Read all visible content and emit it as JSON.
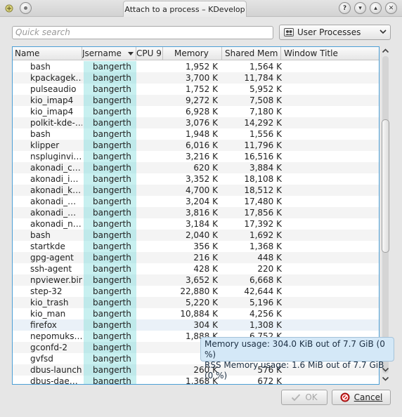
{
  "window": {
    "title": "Attach to a process – KDevelop",
    "controls": [
      "?",
      "▾",
      "▴",
      "✕"
    ]
  },
  "search": {
    "placeholder": "Quick search",
    "value": ""
  },
  "filter": {
    "selected": "User Processes"
  },
  "table": {
    "columns": [
      "Name",
      "Username",
      "CPU %",
      "Memory",
      "Shared Mem",
      "Window Title"
    ],
    "column_labels_visible": [
      "Name",
      "Jsername",
      "CPU 9",
      "Memory",
      "Shared Mem",
      "Window Title"
    ],
    "highlighted_row": 23,
    "rows": [
      {
        "name": "bash",
        "user": "bangerth",
        "mem": "1,952 K",
        "shm": "1,564 K"
      },
      {
        "name": "kpackagek…",
        "user": "bangerth",
        "mem": "3,700 K",
        "shm": "11,784 K"
      },
      {
        "name": "pulseaudio",
        "user": "bangerth",
        "mem": "1,752 K",
        "shm": "5,952 K"
      },
      {
        "name": "kio_imap4",
        "user": "bangerth",
        "mem": "9,272 K",
        "shm": "7,508 K"
      },
      {
        "name": "kio_imap4",
        "user": "bangerth",
        "mem": "6,928 K",
        "shm": "7,180 K"
      },
      {
        "name": "polkit-kde-…",
        "user": "bangerth",
        "mem": "3,076 K",
        "shm": "14,292 K"
      },
      {
        "name": "bash",
        "user": "bangerth",
        "mem": "1,948 K",
        "shm": "1,556 K"
      },
      {
        "name": "klipper",
        "user": "bangerth",
        "mem": "6,016 K",
        "shm": "11,796 K"
      },
      {
        "name": "nspluginvi…",
        "user": "bangerth",
        "mem": "3,216 K",
        "shm": "16,516 K"
      },
      {
        "name": "akonadi_c…",
        "user": "bangerth",
        "mem": "620 K",
        "shm": "3,884 K"
      },
      {
        "name": "akonadi_i…",
        "user": "bangerth",
        "mem": "3,352 K",
        "shm": "18,108 K"
      },
      {
        "name": "akonadi_k…",
        "user": "bangerth",
        "mem": "4,700 K",
        "shm": "18,512 K"
      },
      {
        "name": "akonadi_…",
        "user": "bangerth",
        "mem": "3,204 K",
        "shm": "17,480 K"
      },
      {
        "name": "akonadi_…",
        "user": "bangerth",
        "mem": "3,816 K",
        "shm": "17,856 K"
      },
      {
        "name": "akonadi_n…",
        "user": "bangerth",
        "mem": "3,184 K",
        "shm": "17,392 K"
      },
      {
        "name": "bash",
        "user": "bangerth",
        "mem": "2,040 K",
        "shm": "1,692 K"
      },
      {
        "name": "startkde",
        "user": "bangerth",
        "mem": "356 K",
        "shm": "1,368 K"
      },
      {
        "name": "gpg-agent",
        "user": "bangerth",
        "mem": "216 K",
        "shm": "448 K"
      },
      {
        "name": "ssh-agent",
        "user": "bangerth",
        "mem": "428 K",
        "shm": "220 K"
      },
      {
        "name": "npviewer.bin",
        "user": "bangerth",
        "mem": "3,652 K",
        "shm": "6,668 K"
      },
      {
        "name": "step-32",
        "user": "bangerth",
        "mem": "22,880 K",
        "shm": "42,644 K"
      },
      {
        "name": "kio_trash",
        "user": "bangerth",
        "mem": "5,220 K",
        "shm": "5,196 K"
      },
      {
        "name": "kio_man",
        "user": "bangerth",
        "mem": "10,884 K",
        "shm": "4,256 K"
      },
      {
        "name": "firefox",
        "user": "bangerth",
        "mem": "304 K",
        "shm": "1,308 K"
      },
      {
        "name": "nepomuks…",
        "user": "bangerth",
        "mem": "1,888 K",
        "shm": "6,752 K"
      },
      {
        "name": "gconfd-2",
        "user": "bangerth",
        "mem": "5",
        "shm": ""
      },
      {
        "name": "gvfsd",
        "user": "bangerth",
        "mem": "3",
        "shm": ""
      },
      {
        "name": "dbus-launch",
        "user": "bangerth",
        "mem": "260 K",
        "shm": "576 K"
      },
      {
        "name": "dbus-dae…",
        "user": "bangerth",
        "mem": "1,368 K",
        "shm": "672 K"
      }
    ]
  },
  "tooltip": {
    "line1": "Memory usage: 304.0 KiB out of 7.7 GiB  (0 %)",
    "line2": "RSS Memory usage: 1.6 MiB out of 7.7 GiB  (0 %)"
  },
  "buttons": {
    "ok": "OK",
    "cancel": "Cancel"
  }
}
